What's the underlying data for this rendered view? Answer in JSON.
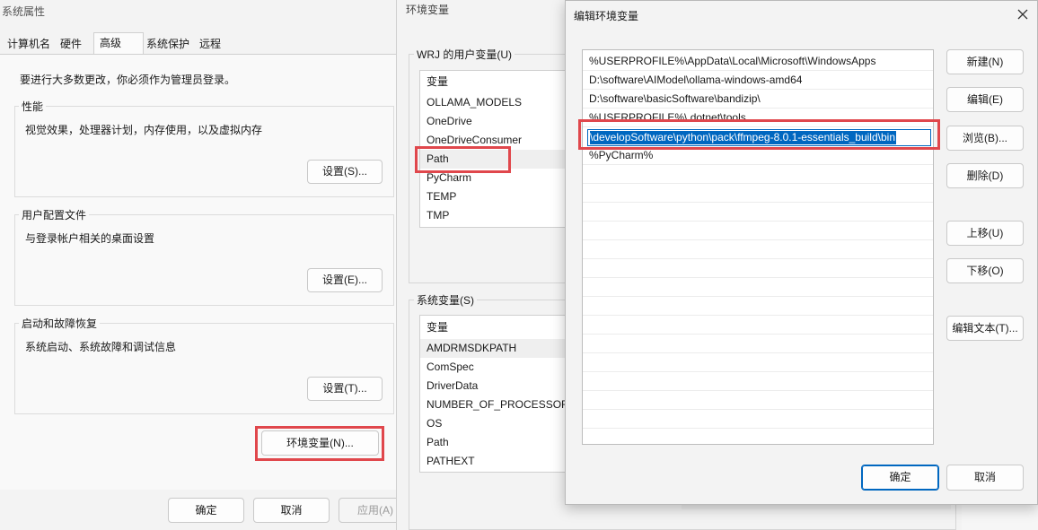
{
  "sys_props": {
    "title": "系统属性",
    "tabs": [
      "计算机名",
      "硬件",
      "高级",
      "系统保护",
      "远程"
    ],
    "admin_note": "要进行大多数更改，你必须作为管理员登录。",
    "performance": {
      "label": "性能",
      "desc": "视觉效果，处理器计划，内存使用，以及虚拟内存",
      "button": "设置(S)..."
    },
    "profile": {
      "label": "用户配置文件",
      "desc": "与登录帐户相关的桌面设置",
      "button": "设置(E)..."
    },
    "startup": {
      "label": "启动和故障恢复",
      "desc": "系统启动、系统故障和调试信息",
      "button": "设置(T)..."
    },
    "env_button": "环境变量(N)...",
    "ok": "确定",
    "cancel": "取消",
    "apply": "应用(A)"
  },
  "env_vars": {
    "title": "环境变量",
    "user_group": "WRJ 的用户变量(U)",
    "user_header": "变量",
    "user_vars": [
      "OLLAMA_MODELS",
      "OneDrive",
      "OneDriveConsumer",
      "Path",
      "PyCharm",
      "TEMP",
      "TMP"
    ],
    "system_group": "系统变量(S)",
    "system_header": "变量",
    "system_vars": [
      "AMDRMSDKPATH",
      "ComSpec",
      "DriverData",
      "NUMBER_OF_PROCESSORS",
      "OS",
      "Path",
      "PATHEXT"
    ]
  },
  "edit_env": {
    "title": "编辑环境变量",
    "close_icon": "close-icon",
    "entries": [
      "%USERPROFILE%\\AppData\\Local\\Microsoft\\WindowsApps",
      "D:\\software\\AIModel\\ollama-windows-amd64",
      "D:\\software\\basicSoftware\\bandizip\\",
      "%USERPROFILE%\\.dotnet\\tools",
      "\\developSoftware\\python\\pack\\ffmpeg-8.0.1-essentials_build\\bin",
      "%PyCharm%"
    ],
    "buttons": {
      "new": "新建(N)",
      "edit": "编辑(E)",
      "browse": "浏览(B)...",
      "delete": "删除(D)",
      "move_up": "上移(U)",
      "move_down": "下移(O)",
      "edit_text": "编辑文本(T)..."
    },
    "ok": "确定",
    "cancel": "取消"
  },
  "colors": {
    "highlight_border": "#e0474c",
    "selection_bg": "#0067c0",
    "accent": "#0067c0"
  }
}
